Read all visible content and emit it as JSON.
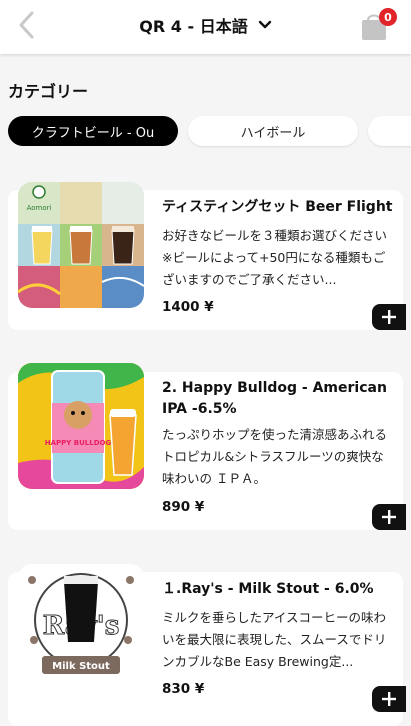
{
  "header": {
    "title": "QR 4 - 日本語",
    "cart_count": "0"
  },
  "category": {
    "heading": "カテゴリー",
    "tabs": [
      {
        "label": "クラフトビール - Ou",
        "active": true
      },
      {
        "label": "ハイボール",
        "active": false
      },
      {
        "label": "",
        "active": false
      }
    ]
  },
  "products": [
    {
      "name": "ティスティングセット Beer Flight",
      "description": "お好きなビールを３種類お選びください ※ビールによって+50円になる種類もございますのでご了承ください...",
      "price": "1400 ¥"
    },
    {
      "name": "2. Happy Bulldog - American IPA -6.5%",
      "description": "たっぷりホップを使った清涼感あふれるトロピカル&シトラスフルーツの爽快な味わいの ＩＰＡ。",
      "price": "890 ¥"
    },
    {
      "name": "１.Ray's - Milk Stout - 6.0%",
      "description": "ミルクを垂らしたアイスコーヒーの味わいを最大限に表現した、スムースでドリンカブルなBe Easy Brewing定...",
      "price": "830 ¥"
    }
  ],
  "images": {
    "flight_label_text": "Aomori",
    "bulldog_label_text": "HAPPY BULLDOG",
    "stout_label_text": "Milk Stout",
    "stout_brand_text": "Ray's"
  },
  "colors": {
    "badge": "#e0242a",
    "active_tab_bg": "#000000",
    "add_button_bg": "#111111"
  }
}
